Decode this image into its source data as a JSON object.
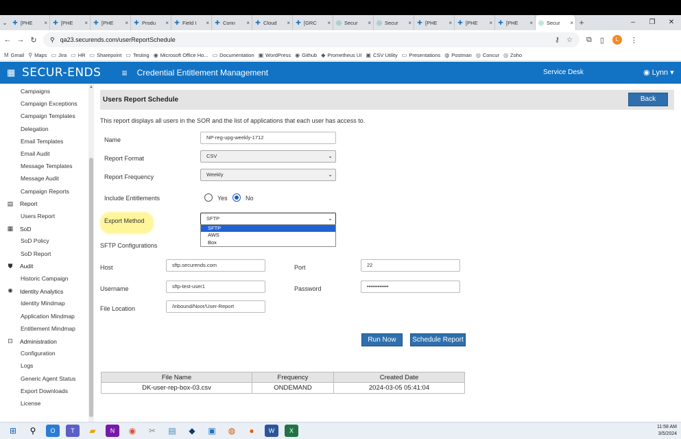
{
  "browser": {
    "tabs": [
      {
        "label": "[PHE",
        "close": "×"
      },
      {
        "label": "[PHE",
        "close": "×"
      },
      {
        "label": "[PHE",
        "close": "×"
      },
      {
        "label": "Produ",
        "close": "×"
      },
      {
        "label": "Field I",
        "close": "×"
      },
      {
        "label": "Conn",
        "close": "×"
      },
      {
        "label": "Cloud",
        "close": "×"
      },
      {
        "label": "[GRC",
        "close": "×"
      },
      {
        "label": "Secur",
        "close": "×"
      },
      {
        "label": "Secur",
        "close": "×"
      },
      {
        "label": "[PHE",
        "close": "×"
      },
      {
        "label": "[PHE",
        "close": "×"
      },
      {
        "label": "[PHE",
        "close": "×"
      },
      {
        "label": "Secur",
        "close": "×"
      }
    ],
    "url": "qa23.securends.com/userReportSchedule",
    "profile_initial": "L",
    "bookmarks": [
      "Gmail",
      "Maps",
      "Jira",
      "HR",
      "Sharepoint",
      "Testing",
      "Microsoft Office Ho...",
      "Documentation",
      "WordPress",
      "Github",
      "Prometheus UI",
      "CSV Utility",
      "Presentations",
      "Postman",
      "Concur",
      "Zoho"
    ]
  },
  "header": {
    "logo": "SECUR-ENDS",
    "title": "Credential Entitlement Management",
    "service_desk": "Service Desk",
    "user": "Lynn"
  },
  "sidebar": {
    "items": [
      "Campaigns",
      "Campaign Exceptions",
      "Campaign Templates",
      "Delegation",
      "Email Templates",
      "Email Audit",
      "Message Templates",
      "Message Audit",
      "Campaign Reports"
    ],
    "sections": [
      {
        "title": "Report",
        "items": [
          "Users Report"
        ]
      },
      {
        "title": "SoD",
        "items": [
          "SoD Policy",
          "SoD Report"
        ]
      },
      {
        "title": "Audit",
        "items": [
          "Historic Campaign"
        ]
      },
      {
        "title": "Identity Analytics",
        "items": [
          "Identity Mindmap",
          "Application Mindmap",
          "Entitlement Mindmap"
        ]
      },
      {
        "title": "Administration",
        "items": [
          "Configuration",
          "Logs",
          "Generic Agent Status",
          "Export Downloads",
          "License"
        ]
      }
    ]
  },
  "main": {
    "page_title": "Users Report Schedule",
    "back_label": "Back",
    "description": "This report displays all users in the SOR and the list of applications that each user has access to.",
    "name_label": "Name",
    "name_value": "NP-reg-upg-weekly-1712",
    "format_label": "Report Format",
    "format_value": "CSV",
    "frequency_label": "Report Frequency",
    "frequency_value": "Weekly",
    "entitlements_label": "Include Entitlements",
    "yes_label": "Yes",
    "no_label": "No",
    "entitlements_selected": "No",
    "export_label": "Export Method",
    "export_value": "SFTP",
    "export_options": [
      "SFTP",
      "AWS",
      "Box"
    ],
    "sftp_title": "SFTP Configurations",
    "host_label": "Host",
    "host_value": "sftp.securends.com",
    "port_label": "Port",
    "port_value": "22",
    "username_label": "Username",
    "username_value": "sftp-test-user1",
    "password_label": "Password",
    "password_value": "••••••••••••",
    "location_label": "File Location",
    "location_value": "/inbound/Noor/User-Report",
    "run_now_label": "Run Now",
    "schedule_label": "Schedule Report",
    "table": {
      "columns": [
        "File Name",
        "Frequency",
        "Created Date"
      ],
      "rows": [
        [
          "DK-user-rep-box-03.csv",
          "ONDEMAND",
          "2024-03-05 05:41:04"
        ]
      ]
    }
  },
  "taskbar": {
    "time": "11:58 AM",
    "date": "3/5/2024"
  }
}
